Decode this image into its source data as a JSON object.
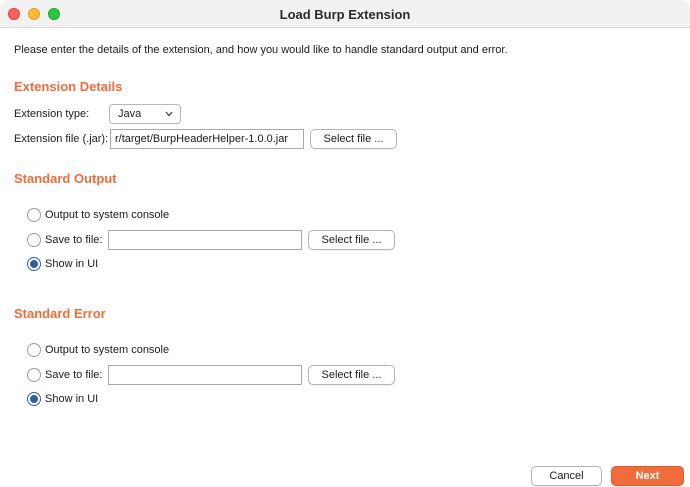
{
  "window": {
    "title": "Load Burp Extension"
  },
  "intro": "Please enter the details of the extension, and how you would like to handle standard output and error.",
  "extension_details": {
    "heading": "Extension Details",
    "type_label": "Extension type:",
    "type_value": "Java",
    "file_label": "Extension file (.jar):",
    "file_value": "r/target/BurpHeaderHelper-1.0.0.jar",
    "select_file": "Select file ..."
  },
  "standard_output": {
    "heading": "Standard Output",
    "options": [
      "Output to system console",
      "Save to file:",
      "Show in UI"
    ],
    "selected": "Show in UI",
    "file_value": "",
    "select_file": "Select file ..."
  },
  "standard_error": {
    "heading": "Standard Error",
    "options": [
      "Output to system console",
      "Save to file:",
      "Show in UI"
    ],
    "selected": "Show in UI",
    "file_value": "",
    "select_file": "Select file ..."
  },
  "footer": {
    "cancel": "Cancel",
    "next": "Next"
  },
  "colors": {
    "accent": "#f26b3a",
    "radio": "#2f5f9e"
  }
}
